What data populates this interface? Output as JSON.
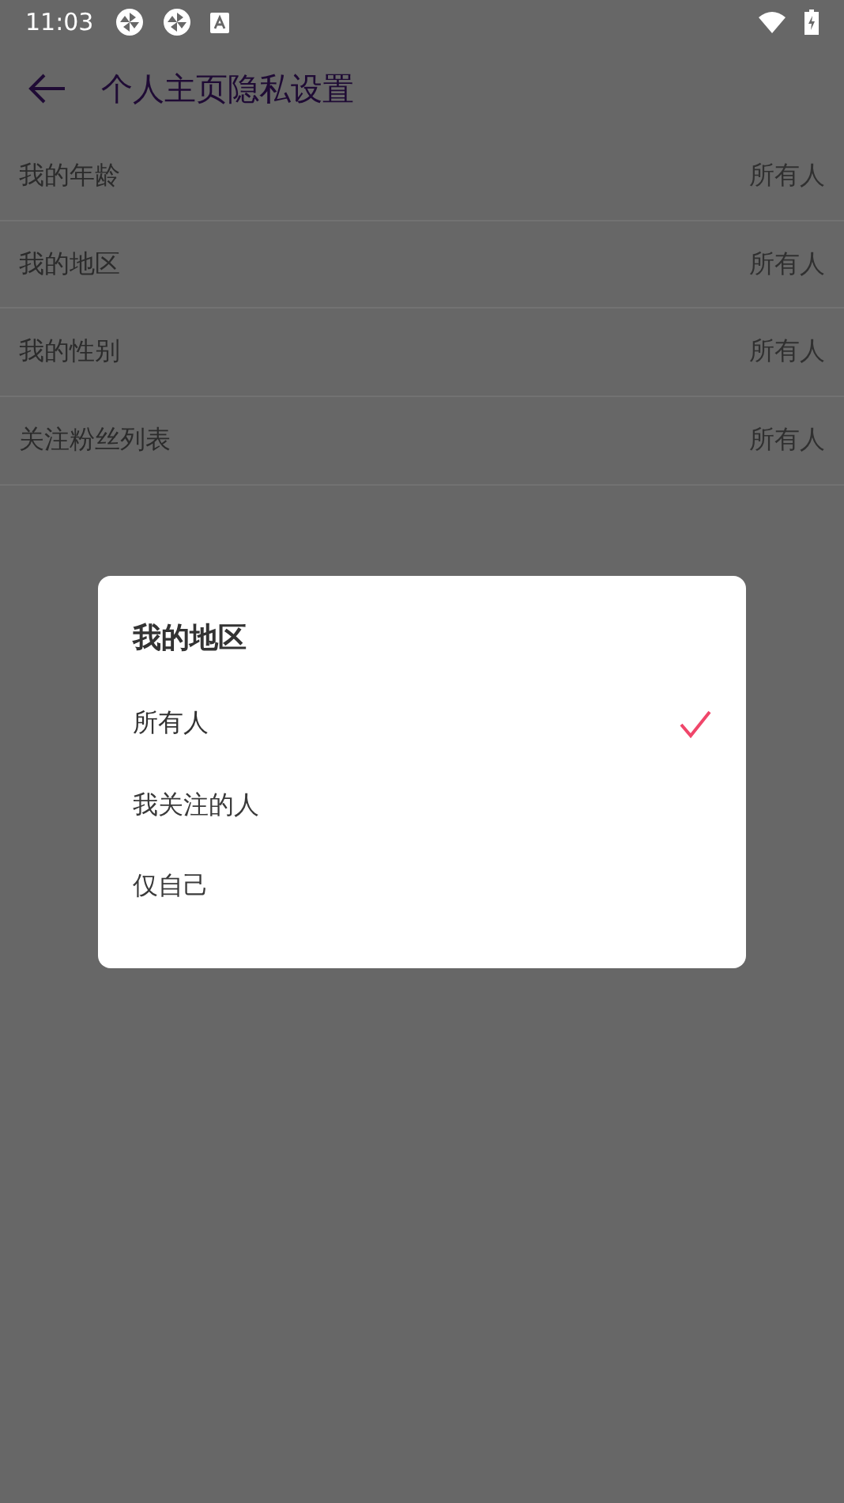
{
  "status_bar": {
    "time": "11:03"
  },
  "toolbar": {
    "title": "个人主页隐私设置"
  },
  "settings": [
    {
      "label": "我的年龄",
      "value": "所有人"
    },
    {
      "label": "我的地区",
      "value": "所有人"
    },
    {
      "label": "我的性别",
      "value": "所有人"
    },
    {
      "label": "关注粉丝列表",
      "value": "所有人"
    }
  ],
  "dialog": {
    "title": "我的地区",
    "options": [
      {
        "label": "所有人",
        "selected": true
      },
      {
        "label": "我关注的人",
        "selected": false
      },
      {
        "label": "仅自己",
        "selected": false
      }
    ]
  }
}
